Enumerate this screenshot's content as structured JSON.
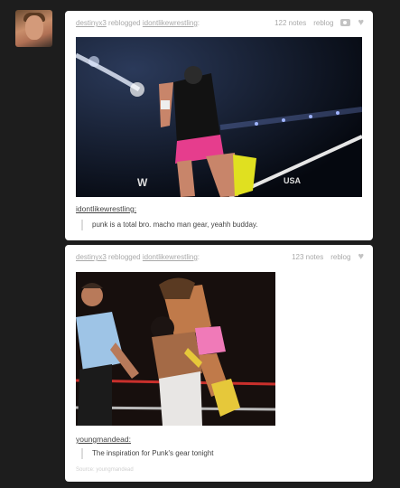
{
  "avatar": {
    "icon": "user-avatar"
  },
  "posts": [
    {
      "reblogger": "destinyx3",
      "reblogged_text": "reblogged",
      "source_user": "idontlikewrestling",
      "colon": ":",
      "notes": "122 notes",
      "reblog": "reblog",
      "caption_user": "idontlikewrestling:",
      "quote": "punk is a total bro. macho man gear, yeahh budday.",
      "image_label": "Wrestler in black shirt and pink trunks standing on ring corner",
      "watermark": "W",
      "network": "USA"
    },
    {
      "reblogger": "destinyx3",
      "reblogged_text": "reblogged",
      "source_user": "idontlikewrestling",
      "colon": ":",
      "notes": "123 notes",
      "reblog": "reblog",
      "caption_user": "youngmandead:",
      "quote": "The inspiration for Punk's gear tonight",
      "source_line": "Source: youngmandead",
      "image_label": "Two wrestlers grappling next to a referee"
    }
  ]
}
